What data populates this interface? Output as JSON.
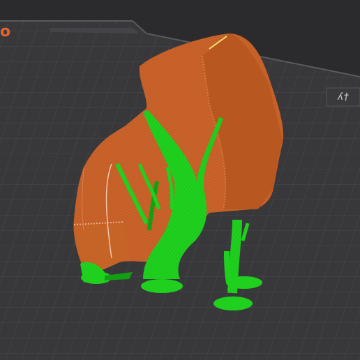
{
  "app": {
    "view": "3d-build-plate-preview"
  },
  "viewport": {
    "logo_text": "o",
    "bed_label_text": "ʎ†",
    "colors": {
      "background": "#2b2b2e",
      "bed_surface": "#3a3a3d",
      "bed_grid": "#4a4a4e",
      "bed_border": "#5a5a5e",
      "model": "#c8622a",
      "model_shade": "#a84f20",
      "support": "#1fd01f",
      "support_shade": "#12a012",
      "accent": "#e8632b"
    }
  },
  "objects": [
    {
      "name": "printed-part",
      "color": "#c8622a"
    },
    {
      "name": "tree-supports",
      "color": "#1fd01f"
    }
  ]
}
